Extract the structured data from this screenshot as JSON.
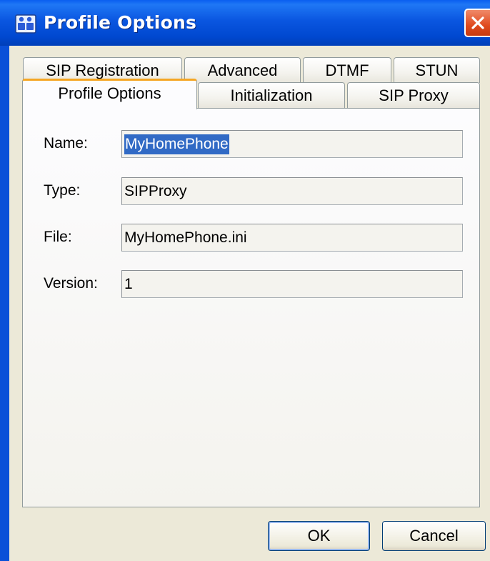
{
  "window": {
    "title": "Profile Options"
  },
  "tabs": {
    "row_back": [
      {
        "label": "SIP Registration"
      },
      {
        "label": "Advanced"
      },
      {
        "label": "DTMF"
      },
      {
        "label": "STUN"
      }
    ],
    "row_front": [
      {
        "label": "Profile Options",
        "selected": true
      },
      {
        "label": "Initialization"
      },
      {
        "label": "SIP Proxy"
      }
    ]
  },
  "form": {
    "name": {
      "label": "Name:",
      "value": "MyHomePhone"
    },
    "type": {
      "label": "Type:",
      "value": "SIPProxy"
    },
    "file": {
      "label": "File:",
      "value": "MyHomePhone.ini"
    },
    "version": {
      "label": "Version:",
      "value": "1"
    }
  },
  "buttons": {
    "ok": "OK",
    "cancel": "Cancel"
  },
  "colors": {
    "titlebar": "#0a56e0",
    "client": "#ece9d8",
    "selected_tab_accent": "#f5a623",
    "selection": "#316ac5"
  },
  "icons": {
    "app": "profile-app-icon",
    "close": "close-icon"
  }
}
